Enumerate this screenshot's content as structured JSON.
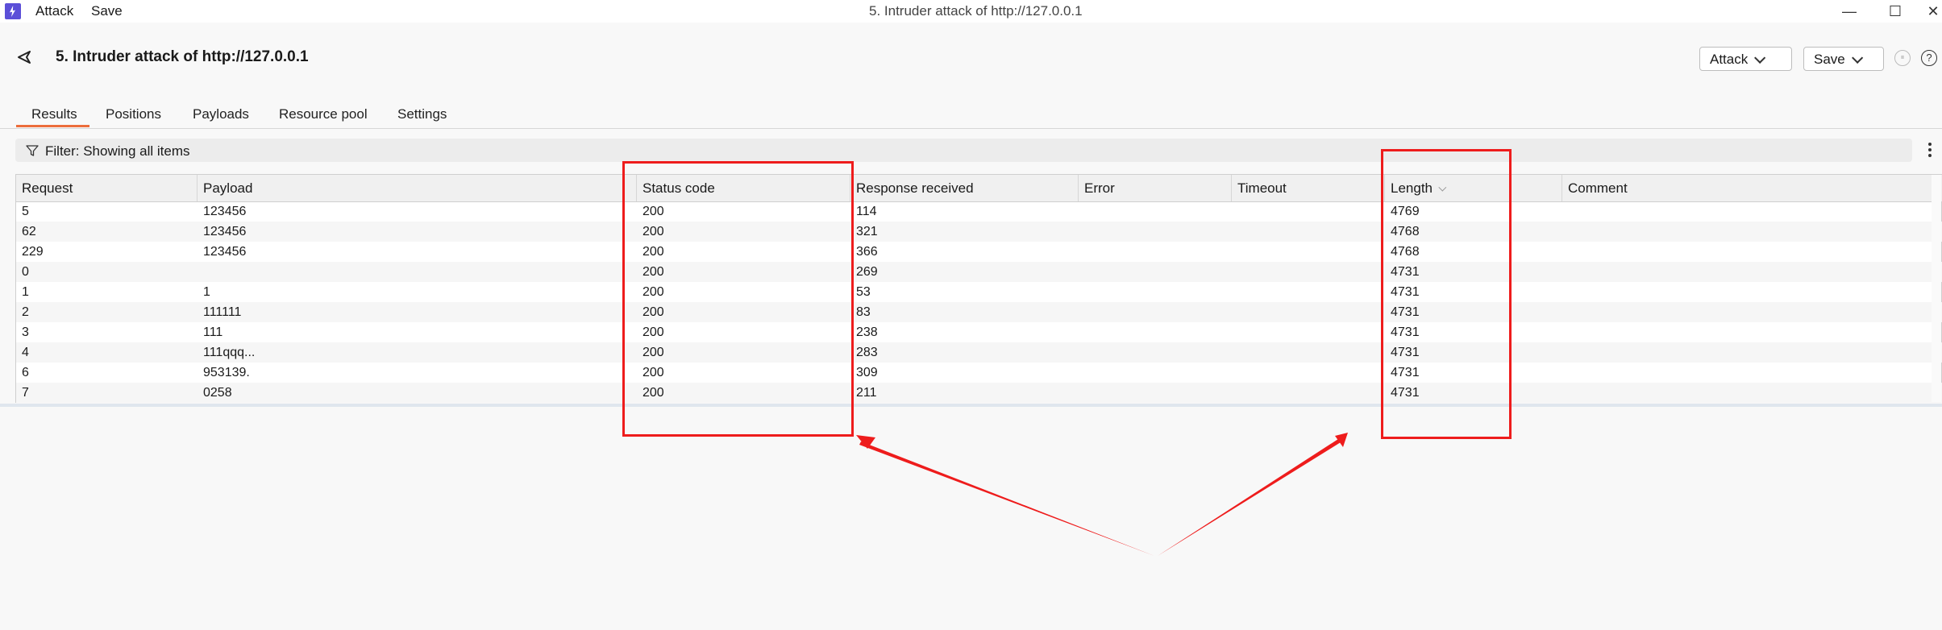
{
  "window": {
    "menu": [
      "Attack",
      "Save"
    ],
    "title": "5. Intruder attack of http://127.0.0.1",
    "controls": {
      "minimize": "—",
      "maximize": "☐",
      "close": "✕"
    }
  },
  "header": {
    "title": "5. Intruder attack of http://127.0.0.1",
    "attack_button": "Attack",
    "save_button": "Save",
    "pause_icon": "⏸",
    "help_icon": "?"
  },
  "tabs": [
    {
      "label": "Results",
      "active": true
    },
    {
      "label": "Positions",
      "active": false
    },
    {
      "label": "Payloads",
      "active": false
    },
    {
      "label": "Resource pool",
      "active": false
    },
    {
      "label": "Settings",
      "active": false
    }
  ],
  "filter": {
    "text": "Filter: Showing all items"
  },
  "table": {
    "columns": [
      "Request",
      "Payload",
      "Status code",
      "Response received",
      "Error",
      "Timeout",
      "Length",
      "Comment"
    ],
    "sorted_column": "Length",
    "rows": [
      [
        "5",
        "123456",
        "200",
        "114",
        "",
        "",
        "4769",
        ""
      ],
      [
        "62",
        "123456",
        "200",
        "321",
        "",
        "",
        "4768",
        ""
      ],
      [
        "229",
        "123456",
        "200",
        "366",
        "",
        "",
        "4768",
        ""
      ],
      [
        "0",
        "",
        "200",
        "269",
        "",
        "",
        "4731",
        ""
      ],
      [
        "1",
        "1",
        "200",
        "53",
        "",
        "",
        "4731",
        ""
      ],
      [
        "2",
        "111111",
        "200",
        "83",
        "",
        "",
        "4731",
        ""
      ],
      [
        "3",
        "111",
        "200",
        "238",
        "",
        "",
        "4731",
        ""
      ],
      [
        "4",
        "111qqq...",
        "200",
        "283",
        "",
        "",
        "4731",
        ""
      ],
      [
        "6",
        "953139.",
        "200",
        "309",
        "",
        "",
        "4731",
        ""
      ],
      [
        "7",
        "0258",
        "200",
        "211",
        "",
        "",
        "4731",
        ""
      ]
    ]
  },
  "colors": {
    "accent": "#ec6d3b",
    "annotation": "#ee1c1c",
    "brand": "#5b4fd8"
  }
}
